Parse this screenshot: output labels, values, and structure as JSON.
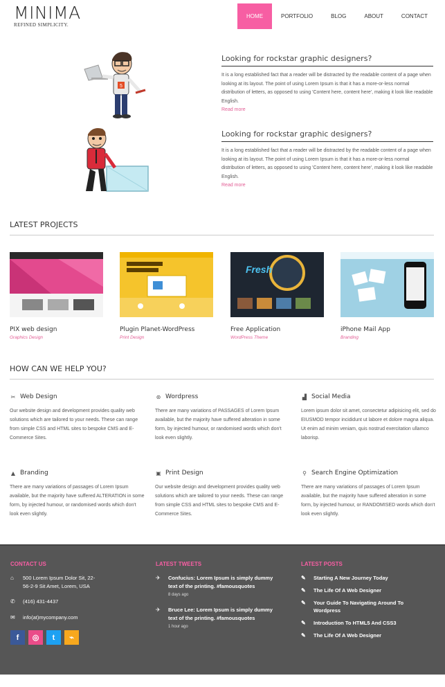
{
  "logo": {
    "name": "MINIMA",
    "tagline": "REFINED SIMPLICITY."
  },
  "nav": [
    "HOME",
    "PORTFOLIO",
    "BLOG",
    "ABOUT",
    "CONTACT"
  ],
  "features": [
    {
      "title": "Looking for rockstar graphic designers?",
      "text": "It is a long established fact that a reader will be distracted by the readable content of a page when looking at its layout. The point of using Lorem Ipsum is that it has a more-or-less normal distribution of letters, as opposed to using 'Content here, content here', making it look like readable English.",
      "link": "Read more"
    },
    {
      "title": "Looking for rockstar graphic designers?",
      "text": "It is a long established fact that a reader will be distracted by the readable content of a page when looking at its layout. The point of using Lorem Ipsum is that it has a more-or-less normal distribution of letters, as opposed to using 'Content here, content here', making it look like readable English.",
      "link": "Read more"
    }
  ],
  "projects_title": "LATEST PROJECTS",
  "projects": [
    {
      "title": "PIX web design",
      "category": "Graphics Design"
    },
    {
      "title": "Plugin Planet-WordPress",
      "category": "Print Design"
    },
    {
      "title": "Free Application",
      "category": "WordPress Theme"
    },
    {
      "title": "iPhone Mail App",
      "category": "Branding"
    }
  ],
  "help_title": "HOW CAN WE HELP YOU?",
  "services": [
    {
      "title": "Web Design",
      "icon": "wrench-icon",
      "text": "Our website design and development provides quality web solutions which are tailored to your needs. These can range from simple CSS and HTML sites to bespoke CMS and E-Commerce Sites."
    },
    {
      "title": "Wordpress",
      "icon": "wordpress-icon",
      "text": "There are many variations of PASSAGES of Lorem Ipsum available, but the majority have suffered alteration in some form, by injected humour, or randomised words which don't look even slightly."
    },
    {
      "title": "Social Media",
      "icon": "thumbs-up-icon",
      "text": "Lorem ipsum dolor sit amet, consectetur adipisicing elit, sed do EIUSMOD tempor incididunt ut labore et dolore magna aliqua. Ut enim ad minim veniam, quis nostrud exercitation ullamco laborisp."
    },
    {
      "title": "Branding",
      "icon": "user-icon",
      "text": "There are many variations of passages of Lorem Ipsum available, but the majority have suffered ALTERATION in some form, by injected humour, or randomised words which don't look even slightly."
    },
    {
      "title": "Print Design",
      "icon": "picture-icon",
      "text": "Our website design and development provides quality web solutions which are tailored to your needs. These can range from simple CSS and HTML sites to bespoke CMS and E-Commerce Sites."
    },
    {
      "title": "Search Engine Optimization",
      "icon": "search-icon",
      "text": "There are many variations of passages of Lorem Ipsum available, but the majority have suffered alteration in some form, by injected humour, or RANDOMISED words which don't look even slightly."
    }
  ],
  "footer": {
    "contact_title": "CONTACT US",
    "address": "500 Lorem Ipsum Dolor Sit, 22-56-2-9 Sit Amet, Lorem, USA",
    "phone": "(416) 431-4437",
    "email": "info(at)mycompany.com",
    "tweets_title": "LATEST TWEETS",
    "tweets": [
      {
        "text": "Confucius: Lorem Ipsum is simply dummy text of the printing. #famousquotes",
        "time": "8 days ago"
      },
      {
        "text": "Bruce Lee: Lorem Ipsum is simply dummy text of the printing. #famousquotes",
        "time": "1 hour ago"
      }
    ],
    "posts_title": "LATEST POSTS",
    "posts": [
      "Starting A New Journey Today",
      "The Life Of A Web Designer",
      "Your Guide To Navigating Around To Wordpress",
      "Introduction To HTML5 And CSS3",
      "The Life Of A Web Designer"
    ],
    "social": [
      "f",
      "◎",
      "t",
      "⌁"
    ]
  },
  "colors": {
    "accent": "#f75ea3",
    "footer_bg": "#565656",
    "facebook": "#3b5998",
    "dribbble": "#ea4c89",
    "twitter": "#1da1f2",
    "rss": "#f7a81e"
  }
}
